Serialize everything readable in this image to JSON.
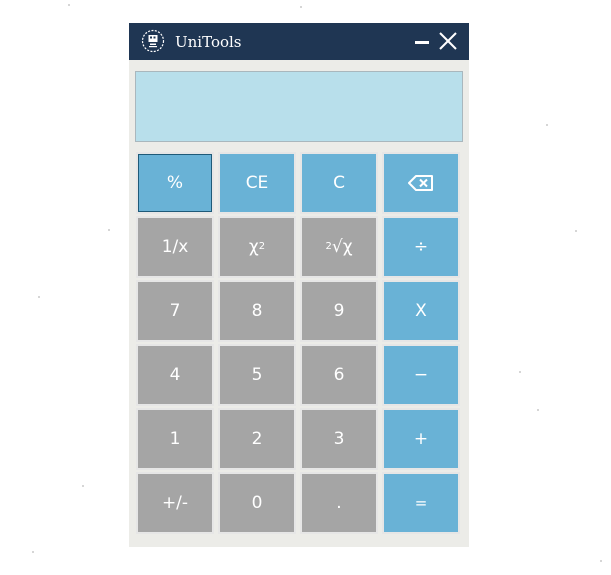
{
  "window": {
    "title": "UniTools",
    "icon": "unitools-app-icon",
    "controls": [
      "minimize-icon",
      "close-icon"
    ]
  },
  "display": {
    "value": ""
  },
  "keys": {
    "percent": "%",
    "clear_entry": "CE",
    "clear": "C",
    "backspace_icon": "backspace-icon",
    "reciprocal": "1/x",
    "square_base": "χ",
    "square_exp": "2",
    "sqrt_index": "2",
    "sqrt_body": "√χ",
    "divide": "÷",
    "seven": "7",
    "eight": "8",
    "nine": "9",
    "multiply": "X",
    "four": "4",
    "five": "5",
    "six": "6",
    "minus": "−",
    "one": "1",
    "two": "2",
    "three": "3",
    "plus": "+",
    "negate": "+/-",
    "zero": "0",
    "decimal": ".",
    "equals": "="
  },
  "colors": {
    "titlebar": "#1f3653",
    "window_bg": "#ecece8",
    "display_bg": "#b8dfeb",
    "key_blue": "#69b2d6",
    "key_gray": "#a5a5a5"
  }
}
